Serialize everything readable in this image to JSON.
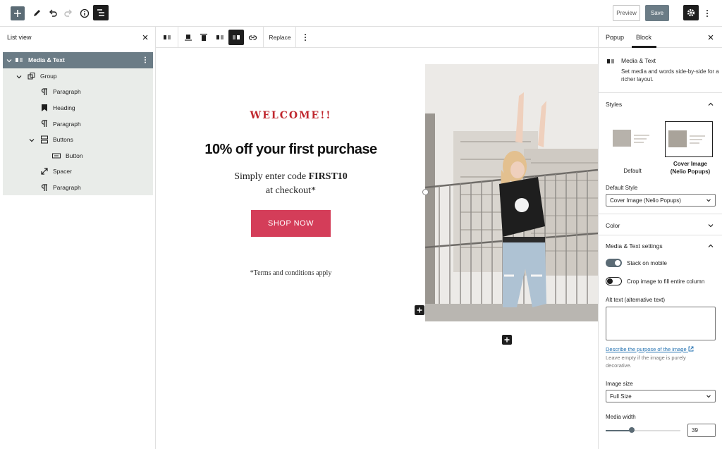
{
  "topbar": {
    "preview_label": "Preview",
    "save_label": "Save"
  },
  "list_view": {
    "title": "List view",
    "items": [
      {
        "label": "Media & Text"
      },
      {
        "label": "Group"
      },
      {
        "label": "Paragraph"
      },
      {
        "label": "Heading"
      },
      {
        "label": "Paragraph"
      },
      {
        "label": "Buttons"
      },
      {
        "label": "Button"
      },
      {
        "label": "Spacer"
      },
      {
        "label": "Paragraph"
      }
    ]
  },
  "block_toolbar": {
    "replace_label": "Replace"
  },
  "canvas": {
    "welcome": "WELCOME!!",
    "headline": "10% off your first purchase",
    "subline_1": "Simply enter code ",
    "code": "FIRST10",
    "subline_2": "at checkout*",
    "button_label": "SHOP NOW",
    "terms": "*Terms and conditions apply"
  },
  "sidebar": {
    "tabs": [
      "Popup",
      "Block"
    ],
    "active_tab": "Block",
    "block_name": "Media & Text",
    "block_desc": "Set media and words side-by-side for a richer layout.",
    "styles": {
      "title": "Styles",
      "options": [
        "Default",
        "Cover Image (Nelio Popups)"
      ],
      "selected": "Cover Image (Nelio Popups)",
      "default_style_label": "Default Style",
      "default_style_value": "Cover Image (Nelio Popups)"
    },
    "color_title": "Color",
    "settings": {
      "title": "Media & Text settings",
      "stack_label": "Stack on mobile",
      "stack_on": true,
      "crop_label": "Crop image to fill entire column",
      "crop_on": false,
      "alt_label": "Alt text (alternative text)",
      "alt_value": "",
      "describe_link": "Describe the purpose of the image",
      "alt_help": "Leave empty if the image is purely decorative.",
      "image_size_label": "Image size",
      "image_size_value": "Full Size",
      "media_width_label": "Media width",
      "media_width_value": "39"
    }
  },
  "colors": {
    "accent_red": "#c0282f",
    "button_pink": "#d43d59",
    "list_selected": "#6b7c86",
    "toggle_on": "#5b6b75",
    "link_blue": "#2271b1"
  }
}
